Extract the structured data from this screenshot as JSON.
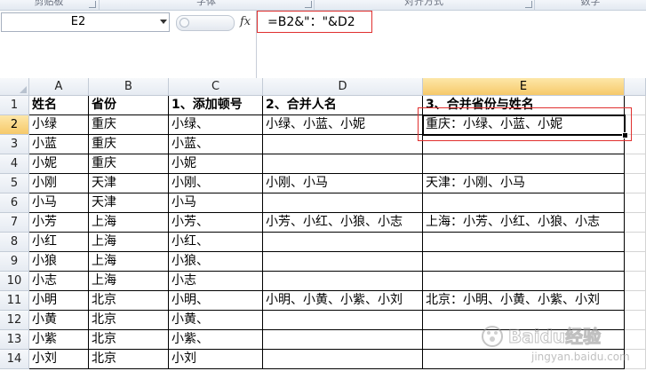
{
  "ribbon": {
    "groups": [
      "剪贴板",
      "字体",
      "对齐方式",
      "数字"
    ]
  },
  "formula_bar": {
    "name_box": "E2",
    "fx_label": "fx",
    "formula": "=B2&\"：\"&D2"
  },
  "grid": {
    "columns": [
      "A",
      "B",
      "C",
      "D",
      "E"
    ],
    "rows": [
      "1",
      "2",
      "3",
      "4",
      "5",
      "6",
      "7",
      "8",
      "9",
      "10",
      "11",
      "12",
      "13",
      "14"
    ],
    "active_cell": "E2",
    "header_row": [
      "姓名",
      "省份",
      "1、添加顿号",
      "2、合并人名",
      "3、合并省份与姓名"
    ],
    "data": [
      [
        "小绿",
        "重庆",
        "小绿、",
        "小绿、小蓝、小妮",
        "重庆：小绿、小蓝、小妮"
      ],
      [
        "小蓝",
        "重庆",
        "小蓝、",
        "",
        ""
      ],
      [
        "小妮",
        "重庆",
        "小妮",
        "",
        ""
      ],
      [
        "小刚",
        "天津",
        "小刚、",
        "小刚、小马",
        "天津：小刚、小马"
      ],
      [
        "小马",
        "天津",
        "小马",
        "",
        ""
      ],
      [
        "小芳",
        "上海",
        "小芳、",
        "小芳、小红、小狼、小志",
        "上海：小芳、小红、小狼、小志"
      ],
      [
        "小红",
        "上海",
        "小红、",
        "",
        ""
      ],
      [
        "小狼",
        "上海",
        "小狼、",
        "",
        ""
      ],
      [
        "小志",
        "上海",
        "小志",
        "",
        ""
      ],
      [
        "小明",
        "北京",
        "小明、",
        "小明、小黄、小紫、小刘",
        "北京：小明、小黄、小紫、小刘"
      ],
      [
        "小黄",
        "北京",
        "小黄、",
        "",
        ""
      ],
      [
        "小紫",
        "北京",
        "小紫、",
        "",
        ""
      ],
      [
        "小刘",
        "北京",
        "小刘",
        "",
        ""
      ]
    ]
  },
  "watermark": {
    "brand": "Baidu经验",
    "url": "jingyan.baidu.com"
  },
  "colors": {
    "highlight": "#e0302f",
    "active_header": "#f6c96a"
  }
}
